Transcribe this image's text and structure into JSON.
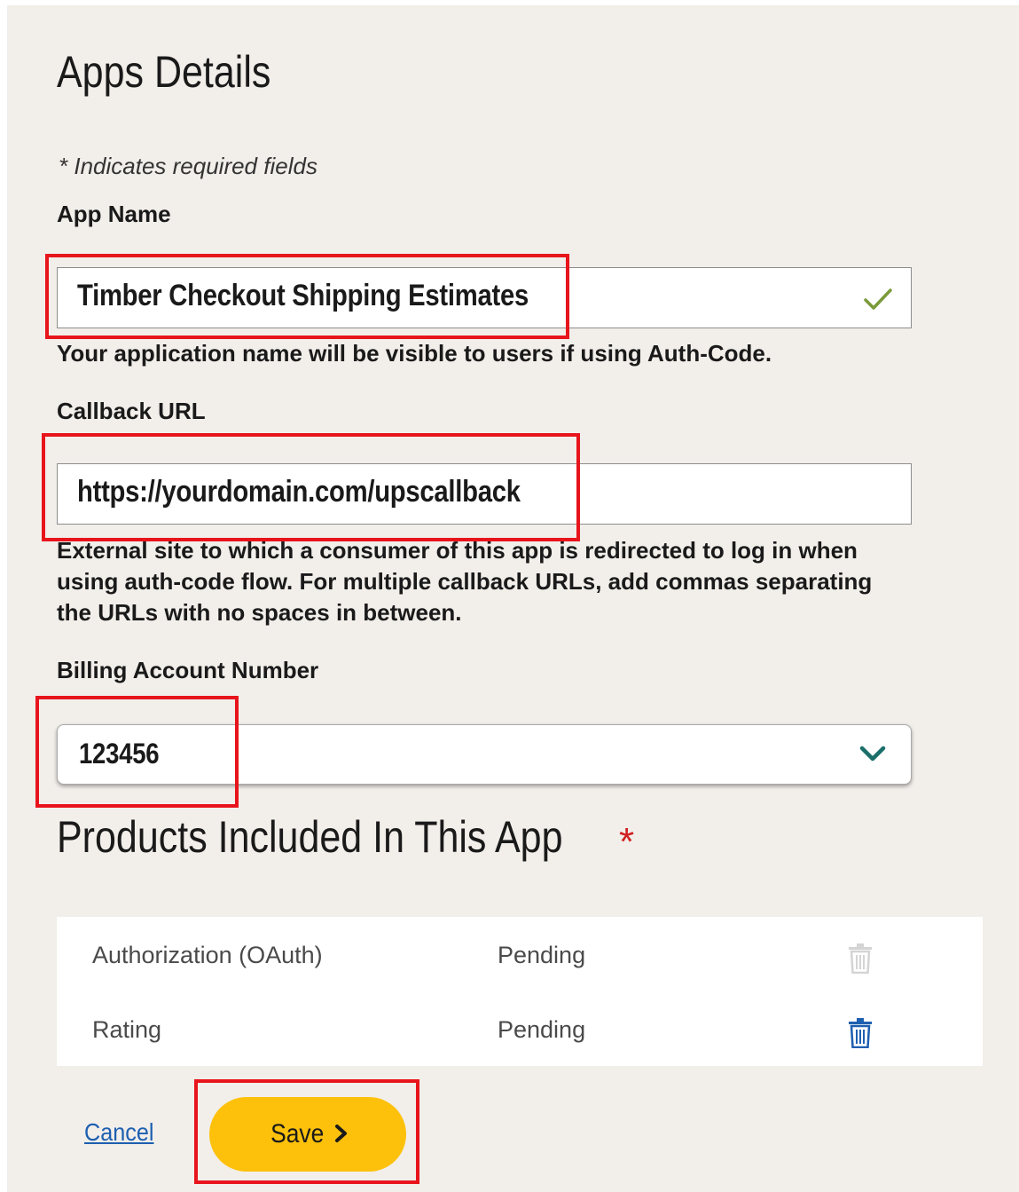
{
  "page_title": "Apps Details",
  "required_note": "* Indicates required fields",
  "app_name": {
    "label": "App Name",
    "value": "Timber Checkout Shipping Estimates",
    "help": "Your application name will be visible to users if using Auth-Code.",
    "valid_icon": "checkmark-icon",
    "valid_color": "#7a9a3a"
  },
  "callback_url": {
    "label": "Callback URL",
    "value": "https://yourdomain.com/upscallback",
    "help": "External site to which a consumer of this app is redirected to log in when using auth-code flow. For multiple callback URLs, add commas separating the URLs with no spaces in between."
  },
  "billing_account": {
    "label": "Billing Account Number",
    "value": "123456",
    "dropdown_icon": "chevron-down-icon",
    "chevron_color": "#1b6f6a"
  },
  "products": {
    "title": "Products Included In This App",
    "required_marker": "*",
    "rows": [
      {
        "name": "Authorization (OAuth)",
        "status": "Pending",
        "delete_enabled": false
      },
      {
        "name": "Rating",
        "status": "Pending",
        "delete_enabled": true
      }
    ]
  },
  "actions": {
    "cancel_label": "Cancel",
    "save_label": "Save"
  },
  "colors": {
    "panel_bg": "#f2eeea",
    "highlight": "#e8141c",
    "save_button": "#fec10b",
    "link": "#1d5fb0",
    "trash_active": "#1d5fb0",
    "trash_disabled": "#d4d4d4",
    "required_star": "#d01f1f"
  }
}
